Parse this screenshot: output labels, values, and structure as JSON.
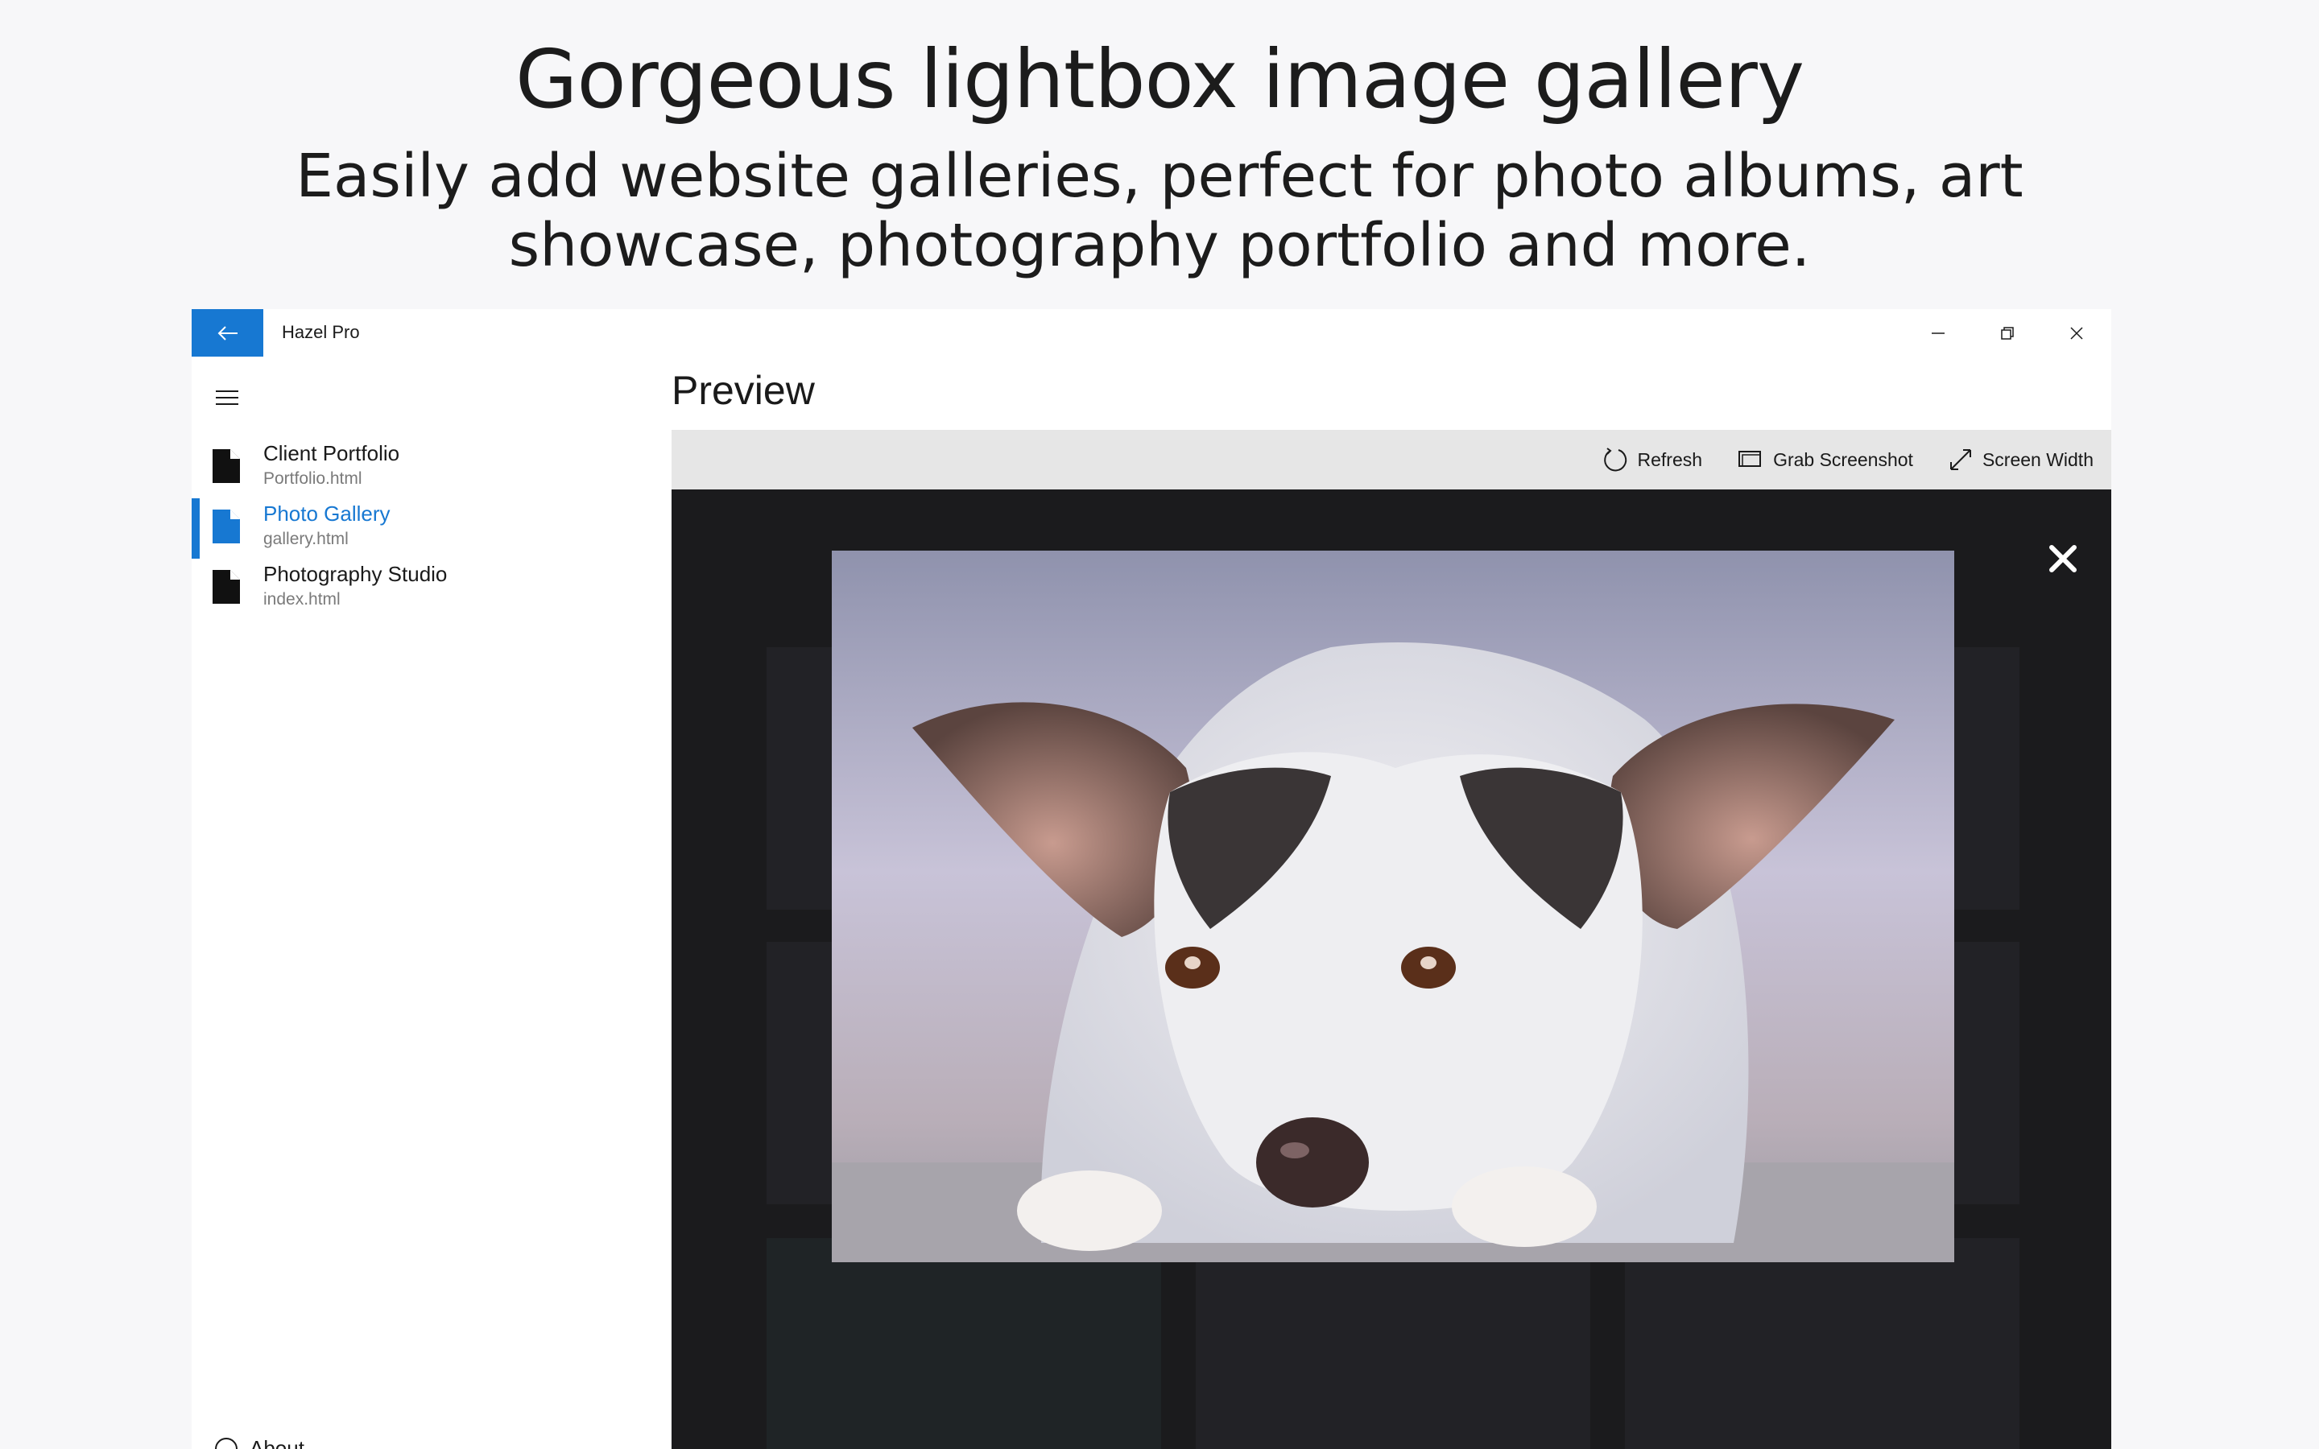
{
  "promo": {
    "title": "Gorgeous lightbox image gallery",
    "subtitle": "Easily add website galleries, perfect for photo albums, art showcase, photography portfolio and more."
  },
  "window": {
    "app_title": "Hazel Pro",
    "accent": "#1778d2"
  },
  "sidebar": {
    "files": [
      {
        "name": "Client Portfolio",
        "path": "Portfolio.html",
        "active": false
      },
      {
        "name": "Photo Gallery",
        "path": "gallery.html",
        "active": true
      },
      {
        "name": "Photography Studio",
        "path": "index.html",
        "active": false
      }
    ],
    "about_label": "About"
  },
  "main": {
    "heading": "Preview",
    "toolbar": {
      "refresh_label": "Refresh",
      "screenshot_label": "Grab Screenshot",
      "screen_width_label": "Screen Width"
    }
  },
  "icons": [
    "back-arrow-icon",
    "minimize-icon",
    "restore-icon",
    "close-icon",
    "hamburger-icon",
    "file-icon",
    "refresh-icon",
    "screenshot-icon",
    "resize-diagonal-icon",
    "lightbox-close-icon",
    "info-icon"
  ]
}
